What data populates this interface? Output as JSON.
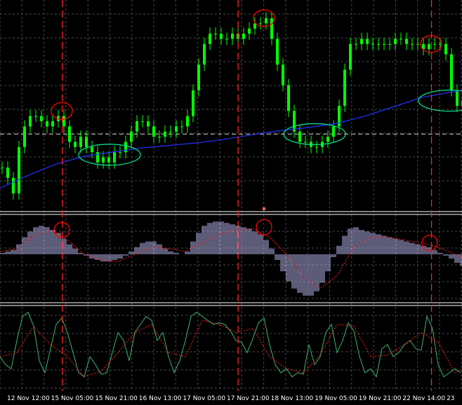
{
  "chart_data": [
    {
      "type": "line",
      "panel": "price",
      "series": [
        {
          "style": "candles",
          "color": "#00ff00",
          "x": [
            0,
            8,
            16,
            24,
            32,
            40,
            48,
            56,
            64,
            72,
            80,
            88,
            96,
            104,
            112,
            120,
            128,
            136,
            144,
            152,
            160,
            168,
            176,
            184,
            192,
            200,
            208,
            216,
            224,
            232,
            240,
            248,
            256,
            264,
            272,
            280,
            288,
            296,
            304,
            312,
            320,
            328,
            336,
            344,
            352,
            360,
            368,
            376,
            384,
            392,
            400,
            408,
            416,
            424,
            432,
            440,
            448,
            456,
            464,
            472,
            480,
            488,
            496,
            504,
            512,
            520,
            528,
            536,
            544,
            552,
            560,
            568,
            576,
            584,
            592,
            600,
            608,
            616,
            624,
            632,
            640,
            648,
            656
          ],
          "values": [
            38,
            36,
            33,
            42,
            46,
            48,
            48,
            47,
            46,
            47,
            48,
            46,
            43,
            42,
            44,
            42,
            41,
            39,
            40,
            39,
            41,
            41,
            43,
            45,
            47,
            47,
            46,
            44,
            44,
            45,
            45,
            46,
            46,
            48,
            53,
            58,
            62,
            64,
            64,
            63,
            63,
            64,
            63,
            64,
            65,
            66,
            66,
            67,
            63,
            58,
            54,
            49,
            45,
            43,
            43,
            42,
            42,
            43,
            44,
            46,
            50,
            57,
            62,
            62,
            63,
            62,
            62,
            62,
            62,
            62,
            63,
            63,
            62,
            62,
            62,
            61,
            62,
            62,
            62,
            60,
            53,
            50,
            51
          ]
        },
        {
          "style": "moving-average",
          "color": "#2233ff",
          "x": [
            0,
            40,
            80,
            120,
            160,
            200,
            240,
            280,
            320,
            360,
            400,
            440,
            480,
            520,
            560,
            600,
            640,
            658
          ],
          "values": [
            34.0,
            36.5,
            38.7,
            40.2,
            41.0,
            41.8,
            42.3,
            42.8,
            43.5,
            44.4,
            45.2,
            45.8,
            46.6,
            48.0,
            49.8,
            51.6,
            52.6,
            53.0
          ]
        }
      ],
      "ylim": [
        30,
        70
      ],
      "reference_level": 44.5,
      "highlight_circles": [
        {
          "x": 88,
          "y": 49,
          "color": "#ff0000"
        },
        {
          "x": 376,
          "y": 67,
          "color": "#ff0000"
        },
        {
          "x": 614,
          "y": 62,
          "color": "#ff0000"
        },
        {
          "x": 156,
          "y": 40.5,
          "color": "#00dd88"
        },
        {
          "x": 448,
          "y": 44.5,
          "color": "#00dd88"
        },
        {
          "x": 640,
          "y": 51,
          "color": "#00dd88"
        }
      ]
    },
    {
      "type": "bar",
      "panel": "oscillator",
      "series": [
        {
          "style": "histogram",
          "color": "#b8b8f0",
          "x": [
            0,
            8,
            16,
            24,
            32,
            40,
            48,
            56,
            64,
            72,
            80,
            88,
            96,
            104,
            112,
            120,
            128,
            136,
            144,
            152,
            160,
            168,
            176,
            184,
            192,
            200,
            208,
            216,
            224,
            232,
            240,
            248,
            256,
            264,
            272,
            280,
            288,
            296,
            304,
            312,
            320,
            328,
            336,
            344,
            352,
            360,
            368,
            376,
            384,
            392,
            400,
            408,
            416,
            424,
            432,
            440,
            448,
            456,
            464,
            472,
            480,
            488,
            496,
            504,
            512,
            520,
            528,
            536,
            544,
            552,
            560,
            568,
            576,
            584,
            592,
            600,
            608,
            616,
            624,
            632,
            640,
            648,
            656
          ],
          "values": [
            0.1,
            0.2,
            0.3,
            0.7,
            1.2,
            1.6,
            1.9,
            2.0,
            1.9,
            1.7,
            1.5,
            1.1,
            0.7,
            0.4,
            0.1,
            -0.1,
            -0.3,
            -0.4,
            -0.5,
            -0.5,
            -0.4,
            -0.3,
            -0.1,
            0.2,
            0.5,
            0.8,
            0.9,
            0.9,
            0.7,
            0.4,
            0.2,
            0.1,
            0.0,
            0.2,
            0.9,
            1.5,
            2.0,
            2.2,
            2.3,
            2.3,
            2.2,
            2.1,
            2.0,
            1.9,
            1.8,
            1.6,
            1.4,
            1.0,
            0.4,
            -0.4,
            -1.2,
            -1.9,
            -2.4,
            -2.7,
            -2.9,
            -2.9,
            -2.6,
            -2.0,
            -1.2,
            -0.2,
            0.6,
            1.3,
            1.8,
            1.9,
            1.7,
            1.6,
            1.5,
            1.4,
            1.3,
            1.2,
            1.1,
            1.0,
            0.9,
            0.8,
            0.7,
            0.6,
            0.5,
            0.3,
            0.1,
            -0.1,
            -0.3,
            -0.6,
            -0.8
          ]
        },
        {
          "style": "signal",
          "color": "#ff2020",
          "x": [
            0,
            24,
            48,
            72,
            96,
            120,
            144,
            168,
            192,
            216,
            240,
            264,
            288,
            312,
            336,
            360,
            384,
            408,
            432,
            456,
            480,
            504,
            528,
            552,
            576,
            600,
            624,
            648,
            658
          ],
          "values": [
            0.2,
            0.4,
            1.3,
            1.7,
            1.0,
            0.0,
            -0.4,
            -0.5,
            0.0,
            0.5,
            0.4,
            0.2,
            0.8,
            1.4,
            1.7,
            1.8,
            1.2,
            0.0,
            -1.6,
            -2.4,
            -1.5,
            0.5,
            1.2,
            1.2,
            1.0,
            0.8,
            0.5,
            0.0,
            -0.2
          ]
        }
      ],
      "ylim": [
        -3.2,
        2.6
      ],
      "highlight_circles": [
        {
          "x": 88,
          "y": 1.7,
          "color": "#ff0000"
        },
        {
          "x": 376,
          "y": 1.9,
          "color": "#ff0000"
        },
        {
          "x": 612,
          "y": 0.8,
          "color": "#ff0000"
        }
      ]
    },
    {
      "type": "line",
      "panel": "stochastic",
      "series": [
        {
          "style": "main",
          "color": "#3cb371",
          "x": [
            0,
            8,
            16,
            24,
            32,
            40,
            48,
            56,
            64,
            72,
            80,
            88,
            96,
            104,
            112,
            120,
            128,
            136,
            144,
            152,
            160,
            168,
            176,
            184,
            192,
            200,
            208,
            216,
            224,
            232,
            240,
            248,
            256,
            264,
            272,
            280,
            288,
            296,
            304,
            312,
            320,
            328,
            336,
            344,
            352,
            360,
            368,
            376,
            384,
            392,
            400,
            408,
            416,
            424,
            432,
            440,
            448,
            456,
            464,
            472,
            480,
            488,
            496,
            504,
            512,
            520,
            528,
            536,
            544,
            552,
            560,
            568,
            576,
            584,
            592,
            600,
            608,
            616,
            624,
            632,
            640,
            648,
            656
          ],
          "values": [
            40,
            30,
            25,
            60,
            90,
            95,
            78,
            35,
            20,
            50,
            80,
            88,
            70,
            45,
            20,
            15,
            40,
            30,
            18,
            20,
            45,
            70,
            60,
            35,
            70,
            80,
            90,
            85,
            60,
            70,
            40,
            20,
            35,
            60,
            90,
            95,
            90,
            85,
            80,
            82,
            80,
            72,
            60,
            58,
            45,
            62,
            82,
            88,
            55,
            30,
            20,
            25,
            15,
            20,
            18,
            55,
            30,
            40,
            70,
            80,
            45,
            60,
            82,
            72,
            40,
            20,
            25,
            15,
            50,
            55,
            40,
            45,
            55,
            60,
            50,
            48,
            90,
            75,
            30,
            15,
            20,
            25,
            20
          ]
        },
        {
          "style": "signal",
          "color": "#ff2020",
          "x": [
            0,
            24,
            48,
            72,
            96,
            120,
            144,
            168,
            192,
            216,
            240,
            264,
            288,
            312,
            336,
            360,
            384,
            408,
            432,
            456,
            480,
            504,
            528,
            552,
            576,
            600,
            624,
            648,
            658
          ],
          "values": [
            40,
            45,
            78,
            55,
            40,
            15,
            22,
            45,
            70,
            80,
            45,
            40,
            85,
            80,
            70,
            75,
            40,
            25,
            20,
            42,
            80,
            78,
            40,
            42,
            55,
            70,
            58,
            20,
            25
          ]
        }
      ],
      "ylim": [
        0,
        100
      ]
    }
  ],
  "x_axis": {
    "tick_labels": [
      "12 Nov 12:00",
      "15 Nov 05:00",
      "15 Nov 21:00",
      "16 Nov 13:00",
      "17 Nov 05:00",
      "17 Nov 21:00",
      "18 Nov 13:00",
      "19 Nov 05:00",
      "19 Nov 21:00",
      "22 Nov 14:00",
      "23"
    ],
    "tick_positions": [
      0,
      1,
      2,
      3,
      4,
      5,
      6,
      7,
      8,
      9,
      10
    ],
    "marker_lines": [
      1.05,
      5.05,
      9.45
    ]
  }
}
